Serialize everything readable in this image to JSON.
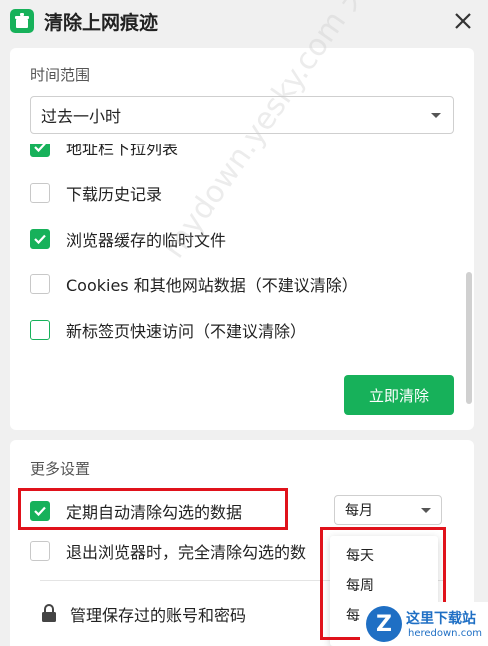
{
  "window": {
    "title": "清除上网痕迹",
    "icon": "broom-trash-icon"
  },
  "time_range": {
    "label": "时间范围",
    "selected": "过去一小时"
  },
  "clear_items": [
    {
      "label": "地址栏下拉列表",
      "checked": true
    },
    {
      "label": "下载历史记录",
      "checked": false
    },
    {
      "label": "浏览器缓存的临时文件",
      "checked": true
    },
    {
      "label": "Cookies 和其他网站数据（不建议清除）",
      "checked": false
    },
    {
      "label": "新标签页快速访问（不建议清除）",
      "checked": false
    }
  ],
  "clear_button": "立即清除",
  "more_settings": {
    "label": "更多设置",
    "auto_clear": {
      "label": "定期自动清除勾选的数据",
      "checked": true
    },
    "frequency": {
      "selected": "每月",
      "options": [
        "每天",
        "每周",
        "每"
      ]
    },
    "exit_clear": {
      "label": "退出浏览器时，完全清除勾选的数",
      "checked": false
    },
    "manage_passwords": "管理保存过的账号和密码"
  },
  "colors": {
    "accent": "#17b15a",
    "highlight": "#e0121b"
  },
  "watermark": {
    "text": "mydown.yesky.com 天极下载站"
  },
  "corner_logo": {
    "letter": "Z",
    "name": "这里下载站",
    "url": "heredown.com"
  }
}
